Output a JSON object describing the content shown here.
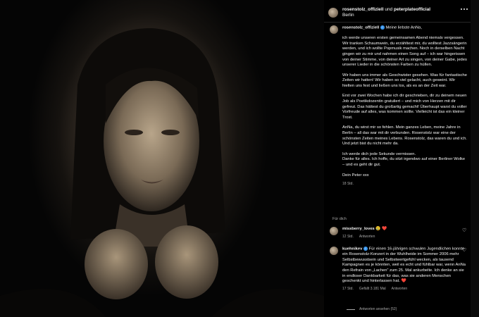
{
  "post": {
    "header": {
      "account_primary": "rosenstolz_offiziell",
      "connector": "und",
      "account_secondary": "peterplateofficial",
      "location": "Berlin"
    },
    "caption": {
      "username": "rosenstolz_offiziell",
      "greeting": "Meine liebste AnNa,",
      "paragraphs": [
        "ich werde unseren ersten gemeinsamen Abend niemals vergessen. Wir tranken Schaumwein, du erzähltest mir, du wolltest Jazzsängerin werden, und ich wollte Popmusik machen. Noch in derselben Nacht gingen wir zu mir und nahmen einen Song auf – ich war hingerissen von deiner Stimme, von deiner Art zu singen, von deiner Gabe, jedes unserer Lieder in die schönsten Farben zu hüllen.",
        "Wir haben uns immer als Geschwister gesehen. Was für fantastische Zeiten wir hatten! Wir haben so viel gelacht, auch geweint. Wir hielten uns fest und ließen uns los, als es an der Zeit war.",
        "Erst vor zwei Wochen habe ich dir geschrieben, dir zu deinem neuen Job als Poetikdozentin gratuliert – und mich von Herzen mit dir gefreut. Das hättest du großartig gemacht! Überhaupt warst du voller Vorfreude auf alles, was kommen sollte. Vielleicht ist das ein kleiner Trost.",
        "AnNa, du wirst mir so fehlen. Mein ganzes Leben, meine Jahre in Berlin – all das war mit dir verbunden. Rosenstolz war eine der schönsten Zeiten meines Lebens. Rosenstolz, das waren du und ich. Und jetzt bist du nicht mehr da.",
        "Ich werde dich jede Sekunde vermissen.\nDanke für alles. Ich hoffe, du sitzt irgendwo auf einer Berliner Wolke – und es geht dir gut.",
        "Dein Peter xxx"
      ],
      "timestamp": "18 Std."
    },
    "section_label": "Für dich",
    "comments": [
      {
        "username": "missberry_loves",
        "text": "😢 ❤️",
        "time": "12 Std.",
        "reply_label": "Antworten",
        "likes": ""
      },
      {
        "username": "kuehnikev",
        "text": "Für einen 16-jährigen schwulen Jugendlichen konnte ein Rosenstolz-Konzert in der Wuhlheide im Sommer 2006 mehr Selbstbewusstsein und Selbstwertgefühl wecken, als tausend Kampagnen es je könnten, weil es echt und fühlbar war, wenn AnNa den Refrain von „Lachen“ zum 25. Mal ankurbelte. Ich denke an sie in endloser Dankbarkeit für das, was sie anderen Menschen geschenkt und hinterlassen hat. ❤️",
        "time": "17 Std.",
        "likes": "Gefällt 3.181 Mal",
        "reply_label": "Antworten"
      }
    ],
    "view_replies": "Antworten ansehen (52)"
  },
  "icons": {
    "more": "more-horizontal-icon",
    "verified": "verified-badge-icon",
    "heart": "heart-icon"
  },
  "colors": {
    "background": "#000000",
    "text": "#f5f5f5",
    "muted": "#a8a8a8",
    "verified": "#3897f0"
  }
}
